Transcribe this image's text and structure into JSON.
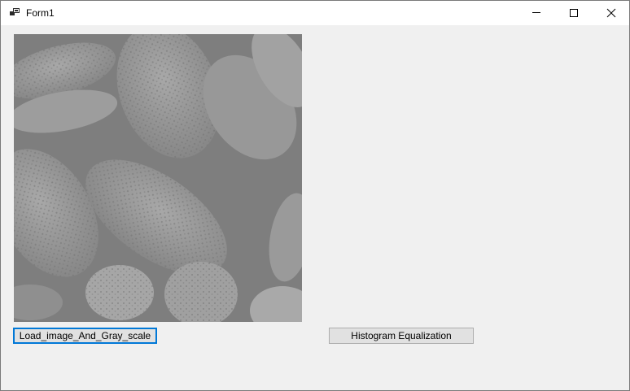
{
  "window": {
    "title": "Form1",
    "icon": "app-window-icon",
    "controls": {
      "minimize_icon": "minimize-icon",
      "maximize_icon": "maximize-icon",
      "close_icon": "close-icon"
    }
  },
  "image": {
    "description_icon": "grayscale-image",
    "tone": "#8c8c8c"
  },
  "buttons": {
    "load_label": "Load_image_And_Gray_scale",
    "hist_label": "Histogram Equalization"
  },
  "colors": {
    "focus_border": "#0078d7",
    "button_face": "#e1e1e1",
    "client_bg": "#f0f0f0"
  }
}
